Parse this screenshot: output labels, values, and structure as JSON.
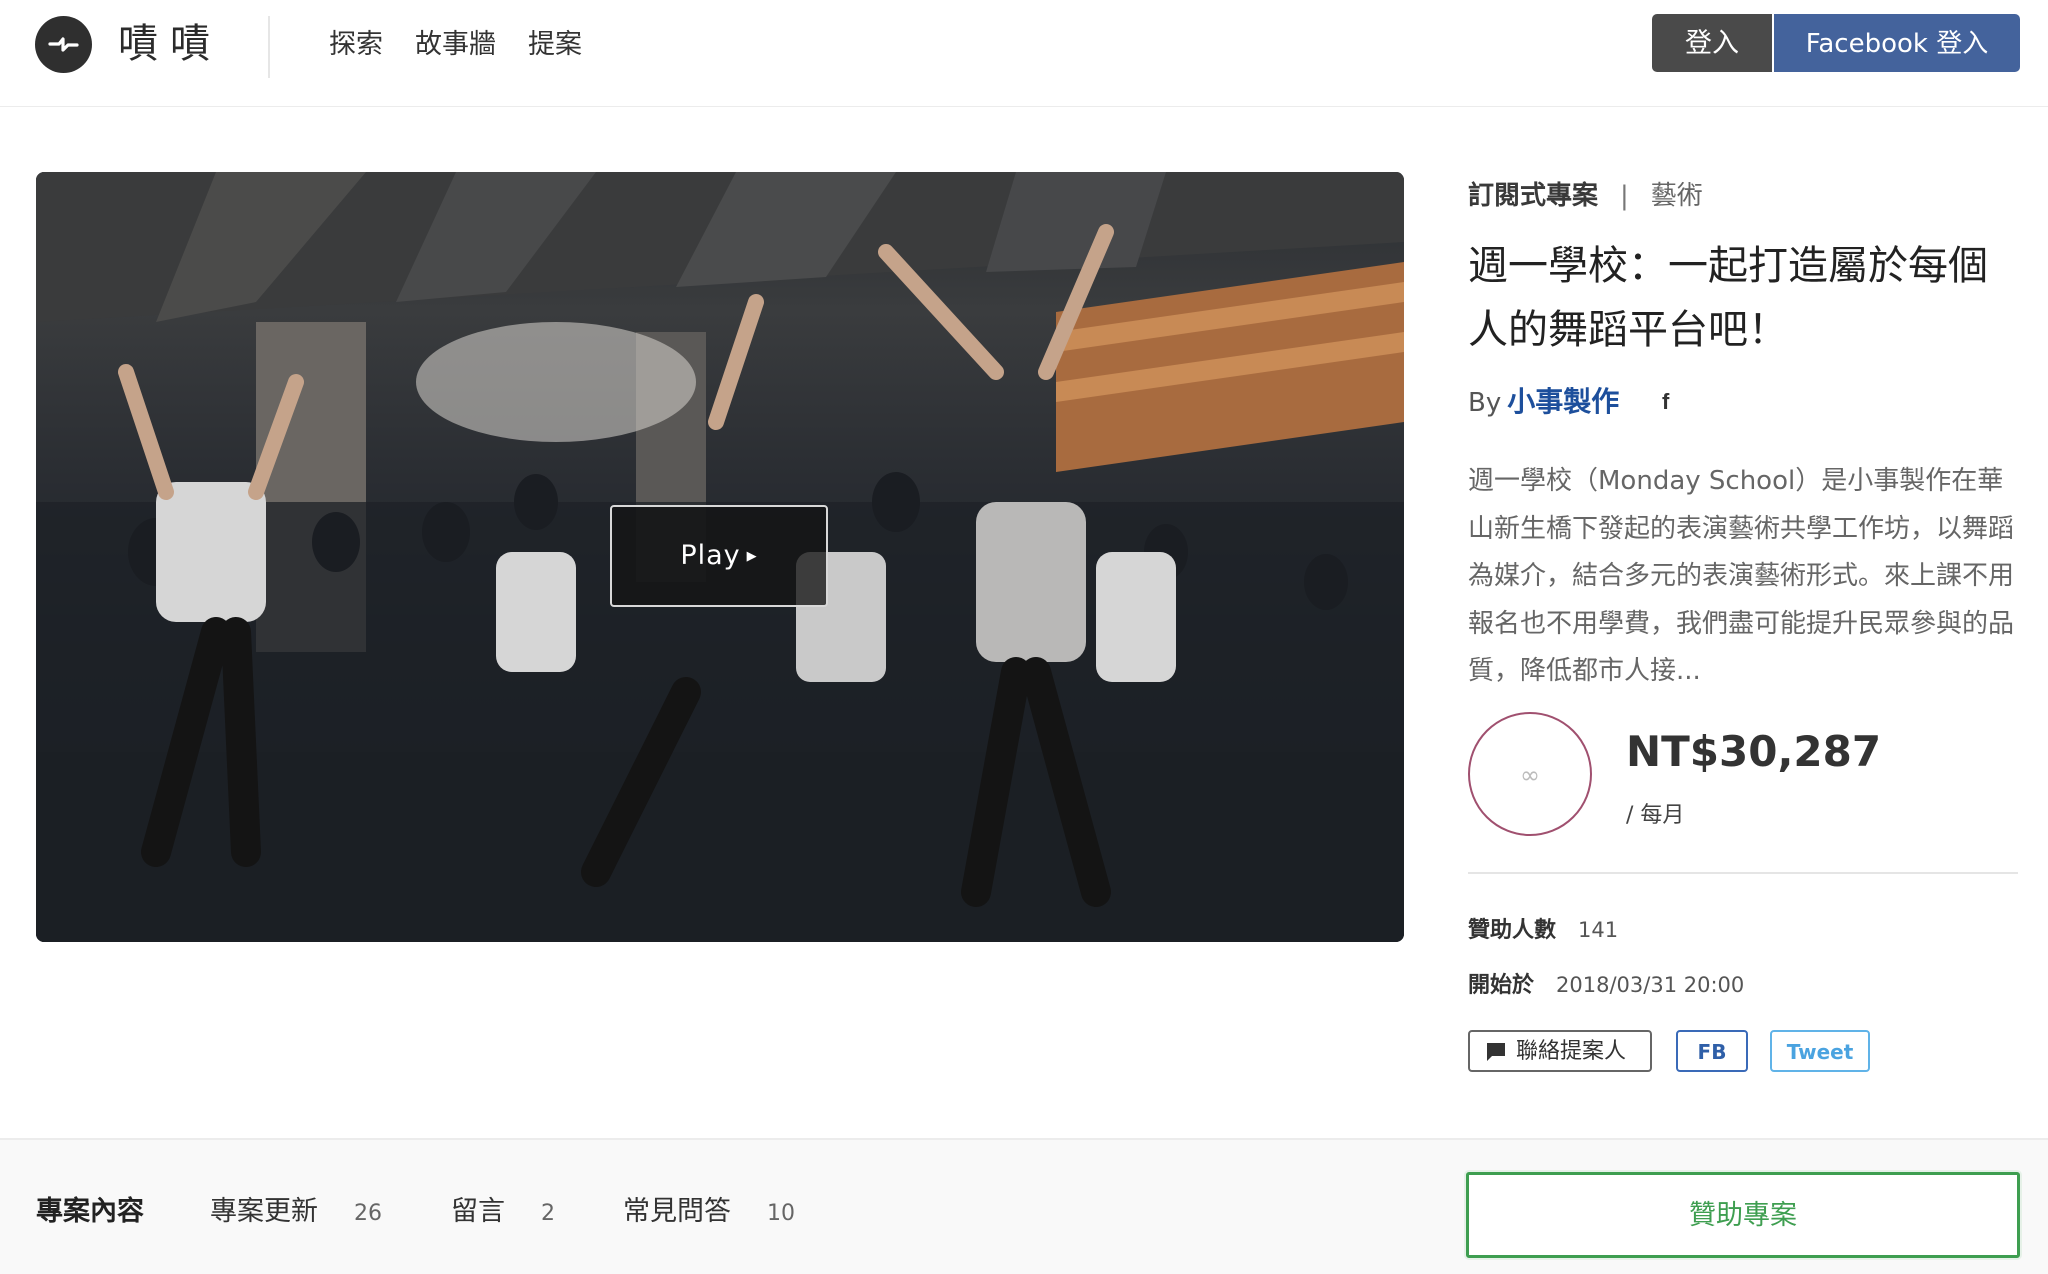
{
  "header": {
    "logo_text": "嘖嘖",
    "nav": [
      "探索",
      "故事牆",
      "提案"
    ],
    "login_label": "登入",
    "facebook_login_label": "Facebook 登入"
  },
  "video": {
    "play_label": "Play"
  },
  "project": {
    "type": "訂閱式專案",
    "separator": "|",
    "category": "藝術",
    "title": "週一學校：一起打造屬於每個人的舞蹈平台吧！",
    "by_label": "By",
    "author": "小事製作",
    "description": "週一學校（Monday School）是小事製作在華山新生橋下發起的表演藝術共學工作坊，以舞蹈為媒介，結合多元的表演藝術形式。來上課不用報名也不用學費，我們盡可能提升民眾參與的品質，降低都市人接...",
    "amount": "NT$30,287",
    "period": "/ 每月",
    "backers_label": "贊助人數",
    "backers_value": "141",
    "start_label": "開始於",
    "start_value": "2018/03/31 20:00",
    "contact_label": "聯絡提案人",
    "fb_share_label": "FB",
    "tweet_label": "Tweet"
  },
  "tabs": [
    {
      "label": "專案內容",
      "count": ""
    },
    {
      "label": "專案更新",
      "count": "26"
    },
    {
      "label": "留言",
      "count": "2"
    },
    {
      "label": "常見問答",
      "count": "10"
    }
  ],
  "back_button_label": "贊助專案",
  "colors": {
    "brand_dark": "#2f2f2f",
    "facebook_blue": "#44639c",
    "author_link": "#1d4f9c",
    "back_button_green": "#3e9e50",
    "tweet_blue": "#4aa3e0"
  }
}
